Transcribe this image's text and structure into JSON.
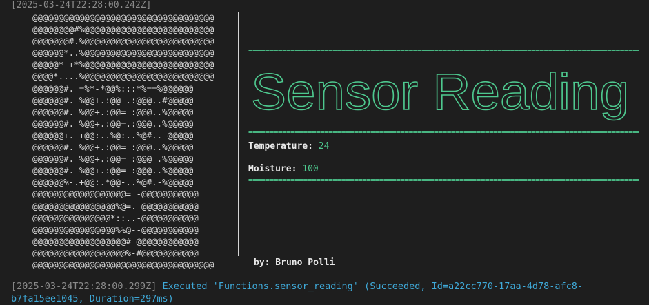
{
  "terminal": {
    "top_timestamp": "[2025-03-24T22:28:00.242Z]",
    "ascii_art_lines": [
      "@@@@@@@@@@@@@@@@@@@@@@@@@@@@@@@@@@@",
      "@@@@@@@@#%@@@@@@@@@@@@@@@@@@@@@@@@@",
      "@@@@@@@#.%@@@@@@@@@@@@@@@@@@@@@@@@@",
      "@@@@@@*..%@@@@@@@@@@@@@@@@@@@@@@@@@",
      "@@@@@*-+*%@@@@@@@@@@@@@@@@@@@@@@@@@",
      "@@@@*....%@@@@@@@@@@@@@@@@@@@@@@@@@",
      "@@@@@@#. =%*-*@@%:::*%==%@@@@@@",
      "@@@@@@#. %@@+.:@@-.:@@@..#@@@@@",
      "@@@@@@#. %@@+.:@@= :@@@..%@@@@@",
      "@@@@@@#. %@@+.:@@=.:@@@..%@@@@@",
      "@@@@@@+. +@@:..%@:..%@#..-@@@@@",
      "@@@@@@#. %@@+.:@@= :@@@..%@@@@@",
      "@@@@@@#. %@@+.:@@= :@@@ .%@@@@@",
      "@@@@@@#. %@@+.:@@= :@@@..%@@@@@",
      "@@@@@@%-.+@@:.*@@-..%@#.-%@@@@@",
      "@@@@@@@@@@@@@@@@@@= -@@@@@@@@@@@",
      "@@@@@@@@@@@@@@@@%@=.-@@@@@@@@@@@",
      "@@@@@@@@@@@@@@@*::..-@@@@@@@@@@@",
      "@@@@@@@@@@@@@@@@%%@--@@@@@@@@@@@",
      "@@@@@@@@@@@@@@@@@@#-@@@@@@@@@@@@",
      "@@@@@@@@@@@@@@@@@@%-#@@@@@@@@@@@",
      "@@@@@@@@@@@@@@@@@@@@@@@@@@@@@@@@@@@"
    ],
    "banner_text": "Sensor Reading",
    "rule_text": "================================================================================================================",
    "temperature_label": "Temperature:",
    "temperature_value": "24",
    "moisture_label": "Moisture:",
    "moisture_value": "100",
    "author": "by: Bruno Polli",
    "log_timestamp": "[2025-03-24T22:28:00.299Z]",
    "log_message": "Executed 'Functions.sensor_reading' (Succeeded, Id=a22cc770-17aa-4d78-afc8-b7fa15ee1045, Duration=297ms)",
    "accent_color": "#4ec98f",
    "log_color": "#3fa9d8"
  }
}
